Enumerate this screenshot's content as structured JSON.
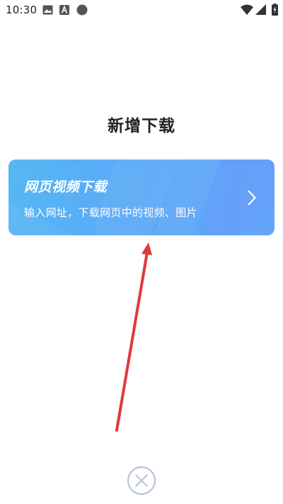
{
  "status_bar": {
    "time": "10:30",
    "icons": [
      "gallery-icon",
      "a-notification-icon",
      "circle-notification-icon",
      "wifi-icon",
      "signal-icon",
      "battery-icon"
    ]
  },
  "page": {
    "title": "新增下载"
  },
  "card": {
    "title": "网页视频下载",
    "subtitle": "输入网址，下载网页中的视频、图片",
    "chevron_icon": "chevron-right-icon",
    "gradient_colors": [
      "#55b8f4",
      "#64a4fb"
    ]
  },
  "close": {
    "icon": "close-circle-icon",
    "color": "#b9c4d3"
  },
  "annotation": {
    "type": "arrow",
    "color": "#e0393c"
  }
}
